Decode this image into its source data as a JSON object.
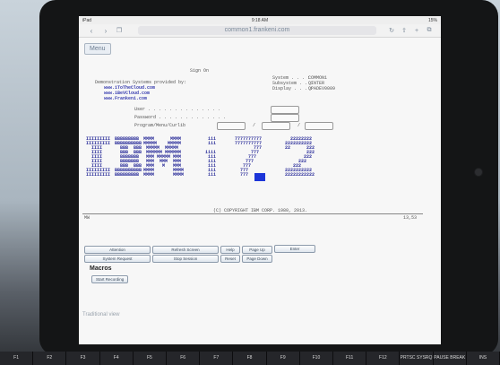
{
  "statusbar": {
    "left": "iPad",
    "time": "9:18 AM",
    "right": "15%"
  },
  "browser": {
    "back": "‹",
    "forward": "›",
    "bookmarks": "bookmarks",
    "url": "common1.frankeni.com",
    "reload": "↻",
    "share": "share",
    "newtab": "+",
    "tabs": "tabs"
  },
  "menu_label": "Menu",
  "terminal": {
    "signon": "Sign On",
    "system_label": "System . . . :",
    "system_value": "COMMON1",
    "subsystem_label": "Subsystem . . :",
    "subsystem_value": "QINTER",
    "display_label": "Display . . . :",
    "display_value": "QPADEV0009",
    "provider_title": "Demonstration Systems provided by:",
    "provider_urls": [
      "www.iToTheCloud.com",
      "www.iBeVCloud.com",
      "www.Frankeni.com"
    ],
    "user_label": "User . . . . . . . . . . . . . .",
    "password_label": "Password . . . . . . . . . . . . .",
    "program_label": "Program/Menu/Curlib",
    "sep1": "/",
    "sep2": "/",
    "copyright": "(C) COPYRIGHT IBM CORP. 1980, 2013.",
    "status_left": "MW",
    "status_right": "13,53"
  },
  "logo": {
    "col1": [
      "IIIIIIIII",
      "IIIIIIIII",
      "  IIII   ",
      "  IIII   ",
      "  IIII   ",
      "  IIII   ",
      "  IIII   ",
      "IIIIIIIII",
      "IIIIIIIII"
    ],
    "col2": [
      "BBBBBBBBB",
      "BBBBBBBBBB",
      "  BBB  BBB",
      "  BBB  BBB",
      "  BBBBBBB ",
      "  BBBBBBB ",
      "  BBB  BBB",
      "BBBBBBBBBB",
      "BBBBBBBBB "
    ],
    "col3": [
      "MMMM      MMMM",
      "MMMMM    MMMMM",
      " MMMMM  MMMMM ",
      " MMMMMM MMMMMM",
      " MMM MMMMM MMM",
      " MMM  MMM  MMM",
      " MMM   M   MMM",
      "MMMM       MMMM",
      "MMMM       MMMM"
    ],
    "col4": [
      "  iii  ",
      "  iii  ",
      "       ",
      " iiii  ",
      "  iii  ",
      "  iii  ",
      "  iii  ",
      "  iii  ",
      "  iii  "
    ],
    "col5": [
      "7777777777",
      "7777777777",
      "       777",
      "      777 ",
      "     777  ",
      "    777   ",
      "   777    ",
      "  777     ",
      "  777     "
    ],
    "col6": [
      "  22222222",
      "2222222222",
      "22      222",
      "        222",
      "       222 ",
      "     222   ",
      "   222     ",
      "2222222222 ",
      "22222222222"
    ]
  },
  "buttons": {
    "attention": "Attention",
    "refresh": "Refresh Screen",
    "help": "Help",
    "pageup": "Page Up",
    "enter": "Enter",
    "sysreq": "System Request",
    "stopsession": "Stop Session",
    "reset": "Reset",
    "pagedown": "Page Down"
  },
  "macros": {
    "title": "Macros",
    "start_recording": "Start Recording"
  },
  "traditional_view": "Traditional view",
  "keyboard_keys": [
    "F1",
    "F2",
    "F3",
    "F4",
    "F5",
    "F6",
    "F7",
    "F8",
    "F9",
    "F10",
    "F11",
    "F12",
    "PRTSC SYSRQ",
    "PAUSE BREAK",
    "INS"
  ]
}
